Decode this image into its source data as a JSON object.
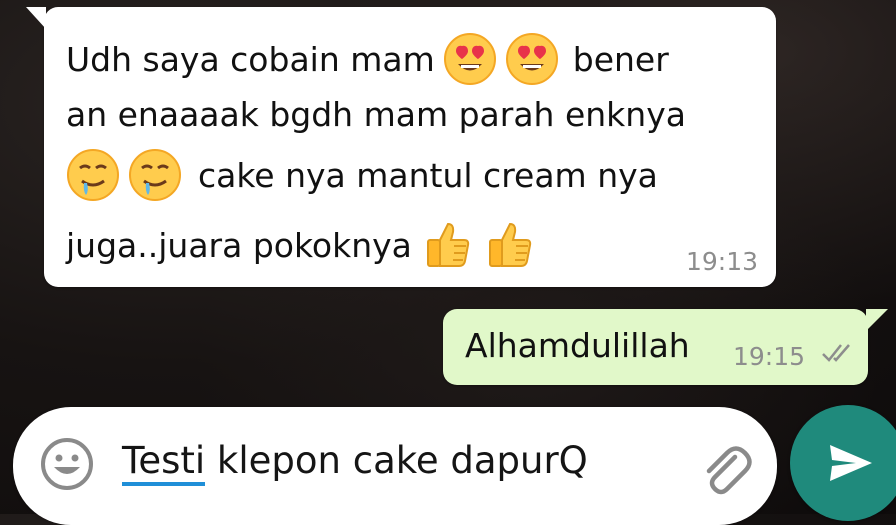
{
  "messages": {
    "incoming": {
      "line1_text_a": "Udh saya cobain mam",
      "line1_text_b": "bener",
      "line2_text": "an enaaaak bgdh mam parah enknya",
      "line3_text": "cake nya mantul cream nya",
      "line4_text": "juga..juara pokoknya",
      "time": "19:13",
      "emoji_heart_eyes": "heart-eyes-face",
      "emoji_drooling": "drooling-face",
      "emoji_thumbs_up": "thumbs-up"
    },
    "outgoing": {
      "text": "Alhamdulillah",
      "time": "19:15",
      "status": "read"
    }
  },
  "composer": {
    "text_misspelled": "Testi",
    "text_rest": " klepon cake dapurQ",
    "emoji_icon": "smiley-icon",
    "attach_icon": "paperclip-icon",
    "send_icon": "send-icon"
  },
  "colors": {
    "incoming_bubble": "#ffffff",
    "outgoing_bubble": "#e1f8c9",
    "send_button": "#1f8a7c",
    "timestamp": "#8d8d8d",
    "read_ticks": "#8d8d8d"
  }
}
